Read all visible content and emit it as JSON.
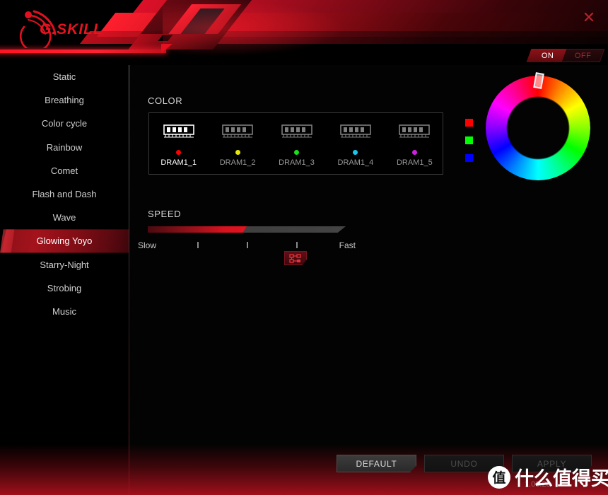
{
  "app": {
    "brand": "G.SKILL",
    "version": "1.00.28",
    "close_label": "✕"
  },
  "power_toggle": {
    "on_label": "ON",
    "off_label": "OFF",
    "state": "ON"
  },
  "sidebar": {
    "items": [
      {
        "label": "Static",
        "active": false
      },
      {
        "label": "Breathing",
        "active": false
      },
      {
        "label": "Color cycle",
        "active": false
      },
      {
        "label": "Rainbow",
        "active": false
      },
      {
        "label": "Comet",
        "active": false
      },
      {
        "label": "Flash and Dash",
        "active": false
      },
      {
        "label": "Wave",
        "active": false
      },
      {
        "label": "Glowing Yoyo",
        "active": true
      },
      {
        "label": "Starry-Night",
        "active": false
      },
      {
        "label": "Strobing",
        "active": false
      },
      {
        "label": "Music",
        "active": false
      }
    ]
  },
  "main": {
    "color_section_label": "COLOR",
    "speed_section_label": "SPEED",
    "dram_modules": [
      {
        "name": "DRAM1_1",
        "color": "#ff0000",
        "selected": true
      },
      {
        "name": "DRAM1_2",
        "color": "#e8e800",
        "selected": false
      },
      {
        "name": "DRAM1_3",
        "color": "#19e019",
        "selected": false
      },
      {
        "name": "DRAM1_4",
        "color": "#16c8ef",
        "selected": false
      },
      {
        "name": "DRAM1_5",
        "color": "#cc22dd",
        "selected": false
      }
    ],
    "link_button_icon": "link-nodes-icon",
    "speed": {
      "slow_label": "Slow",
      "fast_label": "Fast",
      "value_percent": 50,
      "tick_positions": [
        25,
        50,
        75
      ]
    },
    "color_picker": {
      "hue_handle_angle_deg": 10,
      "swatches": [
        {
          "name": "red-swatch",
          "color": "#ff0000"
        },
        {
          "name": "green-swatch",
          "color": "#00ff00"
        },
        {
          "name": "blue-swatch",
          "color": "#0000ff"
        }
      ]
    }
  },
  "footer": {
    "buttons": [
      {
        "label": "DEFAULT",
        "disabled": false
      },
      {
        "label": "UNDO",
        "disabled": true
      },
      {
        "label": "APPLY",
        "disabled": true
      }
    ]
  },
  "watermark": {
    "badge": "值",
    "text": "什么值得买"
  }
}
